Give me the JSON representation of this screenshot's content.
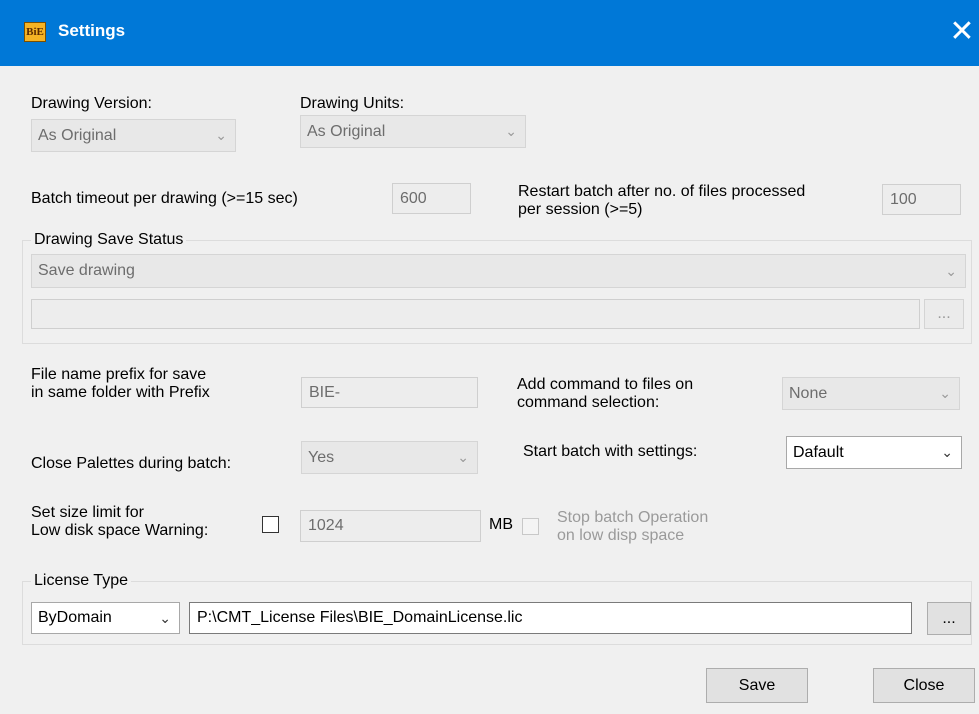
{
  "window": {
    "icon_text": "BiE",
    "title": "Settings",
    "close_glyph": "✕"
  },
  "drawing_version": {
    "label": "Drawing Version:",
    "value": "As Original"
  },
  "drawing_units": {
    "label": "Drawing Units:",
    "value": "As Original"
  },
  "batch_timeout": {
    "label": "Batch timeout per drawing (>=15 sec)",
    "value": "600"
  },
  "restart_batch": {
    "label_line1": "Restart batch after no. of files processed",
    "label_line2": "per session (>=5)",
    "value": "100"
  },
  "save_status": {
    "legend": "Drawing Save Status",
    "value": "Save drawing",
    "path": "",
    "browse_label": "..."
  },
  "prefix": {
    "label_line1": "File name prefix for save",
    "label_line2": "in same folder with Prefix",
    "value": "BIE-"
  },
  "add_command": {
    "label_line1": "Add command to files on",
    "label_line2": "command selection:",
    "value": "None"
  },
  "close_palettes": {
    "label": "Close Palettes during batch:",
    "value": "Yes"
  },
  "start_batch": {
    "label": "Start batch with settings:",
    "value": "Dafault"
  },
  "size_limit": {
    "label_line1": "Set size limit for",
    "label_line2": "Low disk space Warning:",
    "checked": false,
    "value": "1024",
    "unit": "MB",
    "stop_label_line1": "Stop batch Operation",
    "stop_label_line2": "on low disp space"
  },
  "license": {
    "legend": "License Type",
    "type": "ByDomain",
    "path": "P:\\CMT_License Files\\BIE_DomainLicense.lic",
    "browse_label": "..."
  },
  "buttons": {
    "save": "Save",
    "close": "Close"
  },
  "icons": {
    "dropdown": "chevron-down-icon",
    "close": "close-icon",
    "app": "bie-app-icon"
  },
  "colors": {
    "titlebar": "#0078d7",
    "window_bg": "#f0f0f0"
  }
}
